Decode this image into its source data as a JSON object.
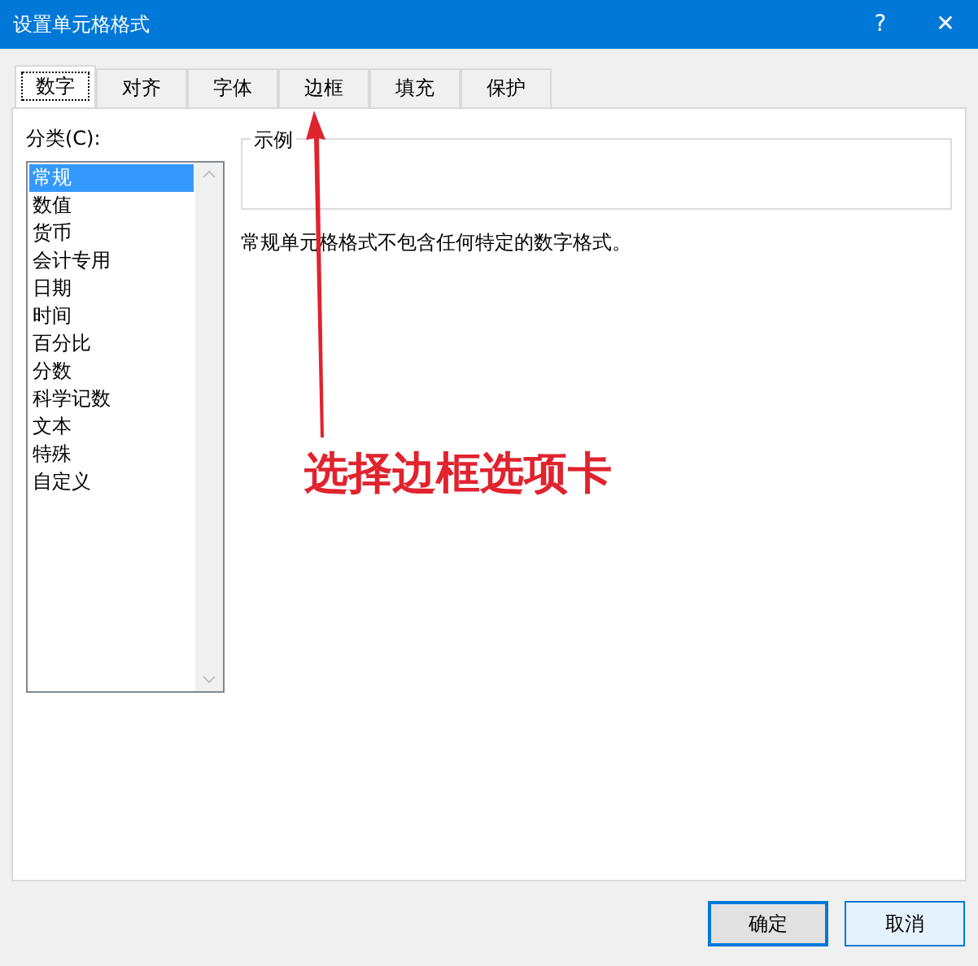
{
  "window": {
    "title": "设置单元格格式",
    "help": "?",
    "close": "✕"
  },
  "tabs": [
    {
      "label": "数字",
      "selected": true
    },
    {
      "label": "对齐",
      "selected": false
    },
    {
      "label": "字体",
      "selected": false
    },
    {
      "label": "边框",
      "selected": false
    },
    {
      "label": "填充",
      "selected": false
    },
    {
      "label": "保护",
      "selected": false
    }
  ],
  "category": {
    "label": "分类(C):",
    "items": [
      {
        "label": "常规",
        "selected": true
      },
      {
        "label": "数值",
        "selected": false
      },
      {
        "label": "货币",
        "selected": false
      },
      {
        "label": "会计专用",
        "selected": false
      },
      {
        "label": "日期",
        "selected": false
      },
      {
        "label": "时间",
        "selected": false
      },
      {
        "label": "百分比",
        "selected": false
      },
      {
        "label": "分数",
        "selected": false
      },
      {
        "label": "科学记数",
        "selected": false
      },
      {
        "label": "文本",
        "selected": false
      },
      {
        "label": "特殊",
        "selected": false
      },
      {
        "label": "自定义",
        "selected": false
      }
    ]
  },
  "sample": {
    "legend": "示例"
  },
  "description": "常规单元格格式不包含任何特定的数字格式。",
  "annotation": {
    "text": "选择边框选项卡"
  },
  "buttons": [
    {
      "label": "确定",
      "primary": true
    },
    {
      "label": "取消",
      "primary": false
    }
  ]
}
